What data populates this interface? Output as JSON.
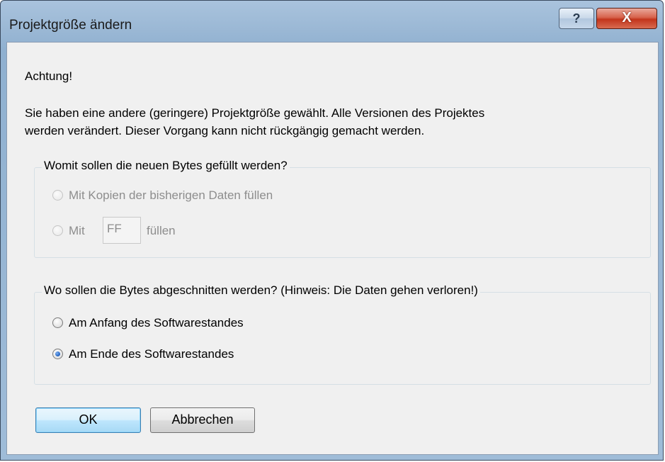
{
  "window": {
    "title": "Projektgröße ändern",
    "help_glyph": "?",
    "close_glyph": "X"
  },
  "warning": {
    "heading": "Achtung!",
    "line1": "Sie haben eine andere (geringere) Projektgröße gewählt. Alle Versionen des Projektes",
    "line2": "werden verändert. Dieser Vorgang kann nicht rückgängig gemacht werden."
  },
  "fill_group": {
    "legend": "Womit sollen die neuen Bytes gefüllt werden?",
    "enabled": false,
    "option_copy": "Mit Kopien der bisherigen Daten füllen",
    "option_with_prefix": "Mit",
    "fill_value": "FF",
    "option_with_suffix": "füllen"
  },
  "cut_group": {
    "legend": "Wo sollen die Bytes abgeschnitten werden? (Hinweis: Die Daten gehen verloren!)",
    "option_start": "Am Anfang des Softwarestandes",
    "option_end": "Am Ende des Softwarestandes",
    "selected": "option_end"
  },
  "buttons": {
    "ok": "OK",
    "cancel": "Abbrechen"
  },
  "colors": {
    "titlebar": "#9bb8d5",
    "client_bg": "#f0f0f0",
    "close_button": "#c2351c",
    "disabled_text": "#8d8d8d",
    "default_button": "#bee6fd"
  }
}
